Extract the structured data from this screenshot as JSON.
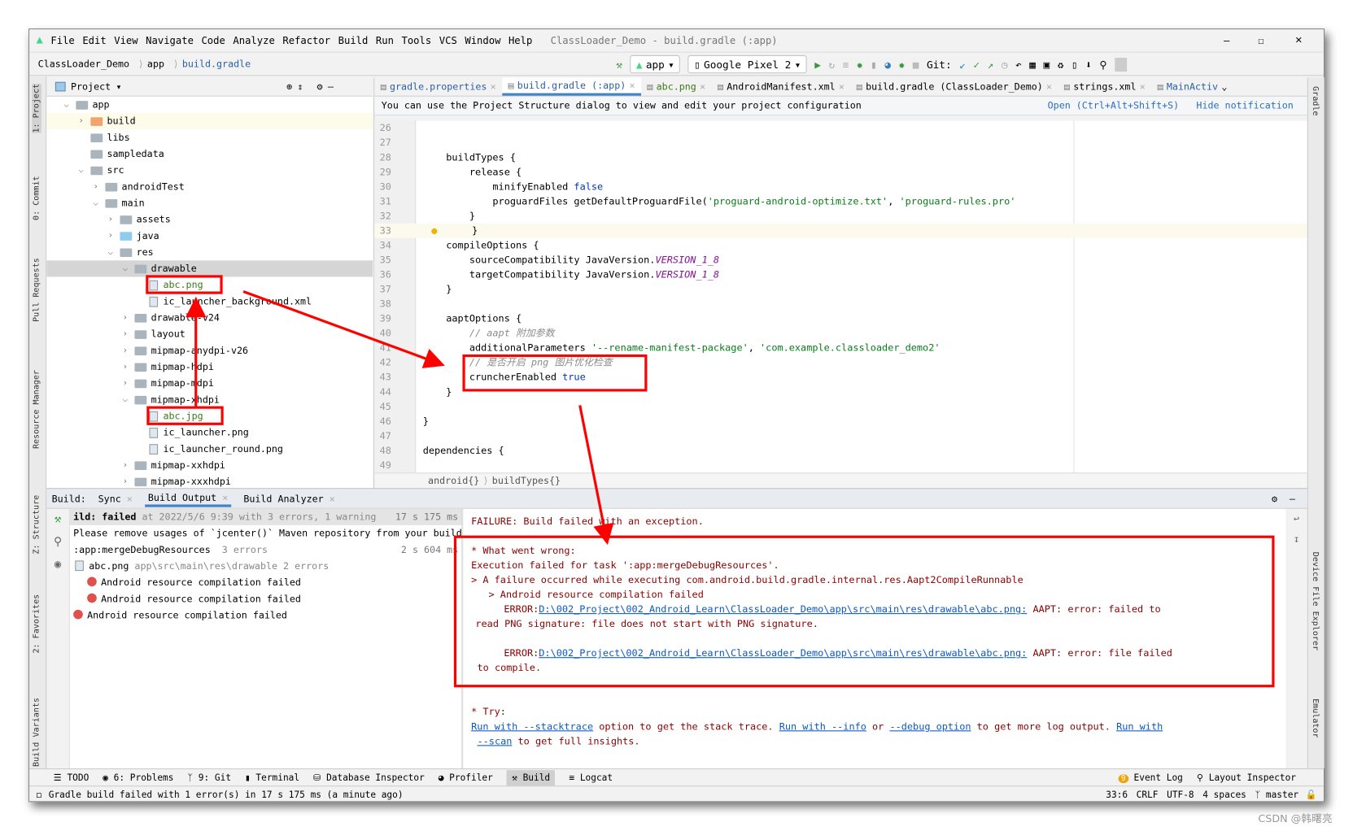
{
  "menu": {
    "items": [
      "File",
      "Edit",
      "View",
      "Navigate",
      "Code",
      "Analyze",
      "Refactor",
      "Build",
      "Run",
      "Tools",
      "VCS",
      "Window",
      "Help"
    ],
    "window_title": "ClassLoader_Demo - build.gradle (:app)"
  },
  "navbar": {
    "crumbs": [
      "ClassLoader_Demo",
      "app",
      "build.gradle"
    ],
    "run_config": "app",
    "device": "Google Pixel 2",
    "git_label": "Git:"
  },
  "project_panel": {
    "title": "Project",
    "tree": [
      {
        "label": "app",
        "depth": 0,
        "chev": "v",
        "type": "module"
      },
      {
        "label": "build",
        "depth": 1,
        "chev": ">",
        "type": "folder-orange"
      },
      {
        "label": "libs",
        "depth": 1,
        "chev": "",
        "type": "folder"
      },
      {
        "label": "sampledata",
        "depth": 1,
        "chev": "",
        "type": "folder"
      },
      {
        "label": "src",
        "depth": 1,
        "chev": "v",
        "type": "folder"
      },
      {
        "label": "androidTest",
        "depth": 2,
        "chev": ">",
        "type": "folder"
      },
      {
        "label": "main",
        "depth": 2,
        "chev": "v",
        "type": "folder"
      },
      {
        "label": "assets",
        "depth": 3,
        "chev": ">",
        "type": "folder"
      },
      {
        "label": "java",
        "depth": 3,
        "chev": ">",
        "type": "folder-blue"
      },
      {
        "label": "res",
        "depth": 3,
        "chev": "v",
        "type": "folder"
      },
      {
        "label": "drawable",
        "depth": 4,
        "chev": "v",
        "type": "folder",
        "selected": true
      },
      {
        "label": "abc.png",
        "depth": 5,
        "chev": "",
        "type": "file",
        "green": true
      },
      {
        "label": "ic_launcher_background.xml",
        "depth": 5,
        "chev": "",
        "type": "file"
      },
      {
        "label": "drawable-v24",
        "depth": 4,
        "chev": ">",
        "type": "folder"
      },
      {
        "label": "layout",
        "depth": 4,
        "chev": ">",
        "type": "folder"
      },
      {
        "label": "mipmap-anydpi-v26",
        "depth": 4,
        "chev": ">",
        "type": "folder"
      },
      {
        "label": "mipmap-hdpi",
        "depth": 4,
        "chev": ">",
        "type": "folder"
      },
      {
        "label": "mipmap-mdpi",
        "depth": 4,
        "chev": ">",
        "type": "folder"
      },
      {
        "label": "mipmap-xhdpi",
        "depth": 4,
        "chev": "v",
        "type": "folder"
      },
      {
        "label": "abc.jpg",
        "depth": 5,
        "chev": "",
        "type": "file",
        "green": true
      },
      {
        "label": "ic_launcher.png",
        "depth": 5,
        "chev": "",
        "type": "file"
      },
      {
        "label": "ic_launcher_round.png",
        "depth": 5,
        "chev": "",
        "type": "file"
      },
      {
        "label": "mipmap-xxhdpi",
        "depth": 4,
        "chev": ">",
        "type": "folder"
      },
      {
        "label": "mipmap-xxxhdpi",
        "depth": 4,
        "chev": ">",
        "type": "folder"
      }
    ]
  },
  "left_stripe": [
    "1: Project",
    "0: Commit",
    "Pull Requests",
    "Resource Manager",
    "Z: Structure",
    "2: Favorites",
    "Build Variants"
  ],
  "right_stripe": [
    "Gradle",
    "Device File Explorer",
    "Emulator"
  ],
  "editor": {
    "tabs": [
      {
        "label": "gradle.properties"
      },
      {
        "label": "build.gradle (:app)",
        "active": true
      },
      {
        "label": "abc.png"
      },
      {
        "label": "AndroidManifest.xml"
      },
      {
        "label": "build.gradle (ClassLoader_Demo)"
      },
      {
        "label": "strings.xml"
      },
      {
        "label": "MainActiv"
      }
    ],
    "notification": {
      "text": "You can use the Project Structure dialog to view and edit your project configuration",
      "open": "Open (Ctrl+Alt+Shift+S)",
      "hide": "Hide notification"
    },
    "lines": [
      {
        "n": "26",
        "segs": []
      },
      {
        "n": "27",
        "segs": []
      },
      {
        "n": "28",
        "segs": [
          [
            "    buildTypes {",
            ""
          ]
        ]
      },
      {
        "n": "29",
        "segs": [
          [
            "        release {",
            ""
          ]
        ]
      },
      {
        "n": "30",
        "segs": [
          [
            "            minifyEnabled ",
            ""
          ],
          [
            "false",
            "kw"
          ]
        ]
      },
      {
        "n": "31",
        "segs": [
          [
            "            proguardFiles getDefaultProguardFile(",
            ""
          ],
          [
            "'proguard-android-optimize.txt'",
            "str"
          ],
          [
            ", ",
            ""
          ],
          [
            "'proguard-rules.pro'",
            "str"
          ]
        ]
      },
      {
        "n": "32",
        "segs": [
          [
            "        }",
            ""
          ]
        ]
      },
      {
        "n": "33",
        "segs": [
          [
            "    }",
            ""
          ]
        ],
        "current": true
      },
      {
        "n": "34",
        "segs": [
          [
            "    compileOptions {",
            ""
          ]
        ]
      },
      {
        "n": "35",
        "segs": [
          [
            "        sourceCompatibility JavaVersion.",
            ""
          ],
          [
            "VERSION_1_8",
            "it"
          ]
        ]
      },
      {
        "n": "36",
        "segs": [
          [
            "        targetCompatibility JavaVersion.",
            ""
          ],
          [
            "VERSION_1_8",
            "it"
          ]
        ]
      },
      {
        "n": "37",
        "segs": [
          [
            "    }",
            ""
          ]
        ]
      },
      {
        "n": "38",
        "segs": []
      },
      {
        "n": "39",
        "segs": [
          [
            "    aaptOptions {",
            ""
          ]
        ]
      },
      {
        "n": "40",
        "segs": [
          [
            "        // aapt 附加参数",
            "cm"
          ]
        ]
      },
      {
        "n": "41",
        "segs": [
          [
            "        additionalParameters ",
            ""
          ],
          [
            "'--rename-manifest-package'",
            "str"
          ],
          [
            ", ",
            ""
          ],
          [
            "'com.example.classloader_demo2'",
            "str"
          ]
        ]
      },
      {
        "n": "42",
        "segs": [
          [
            "        // 是否开启 png 图片优化检查",
            "cm"
          ]
        ]
      },
      {
        "n": "43",
        "segs": [
          [
            "        cruncherEnabled ",
            ""
          ],
          [
            "true",
            "kw"
          ]
        ]
      },
      {
        "n": "44",
        "segs": [
          [
            "    }",
            ""
          ]
        ]
      },
      {
        "n": "45",
        "segs": []
      },
      {
        "n": "46",
        "segs": [
          [
            "}",
            ""
          ]
        ]
      },
      {
        "n": "47",
        "segs": []
      },
      {
        "n": "48",
        "segs": [
          [
            "dependencies {",
            ""
          ]
        ]
      },
      {
        "n": "49",
        "segs": []
      }
    ],
    "breadcrumb": [
      "android{}",
      "buildTypes{}"
    ]
  },
  "build": {
    "label": "Build:",
    "tabs": [
      "Sync",
      "Build Output",
      "Build Analyzer"
    ],
    "tree": [
      {
        "text": "ild: failed",
        "muted": " at 2022/5/6 9:39 with 3 errors, 1 warning",
        "time": "17 s 175 ms",
        "header": true
      },
      {
        "text": "Please remove usages of `jcenter()` Maven repository from your build"
      },
      {
        "text": ":app:mergeDebugResources",
        "muted": "  3 errors",
        "time": "2 s 604 ms"
      },
      {
        "text": "abc.png",
        "muted": " app\\src\\main\\res\\drawable 2 errors",
        "icon": "file"
      },
      {
        "text": "Android resource compilation failed",
        "icon": "error",
        "indent": 2
      },
      {
        "text": "Android resource compilation failed",
        "icon": "error",
        "indent": 2
      },
      {
        "text": "Android resource compilation failed",
        "icon": "error",
        "indent": 0
      }
    ],
    "console": {
      "failure": "FAILURE: Build failed with an exception.",
      "what": "* What went wrong:",
      "exec": "Execution failed for task ':app:mergeDebugResources'.",
      "fail1": "> A failure occurred while executing com.android.build.gradle.internal.res.Aapt2CompileRunnable",
      "fail2": "   > Android resource compilation failed",
      "error_prefix": "ERROR:",
      "error_path": "D:\\002_Project\\002_Android_Learn\\ClassLoader_Demo\\app\\src\\main\\res\\drawable\\abc.png:",
      "err1_tail": " AAPT: error: failed to",
      "err1_cont": "read PNG signature: file does not start with PNG signature.",
      "err2_tail": " AAPT: error: file failed",
      "err2_cont": "to compile.",
      "try": "* Try:",
      "try_l1": "Run with --stacktrace",
      "try_t1": " option to get the stack trace. ",
      "try_l2": "Run with --info",
      "try_t2": " or ",
      "try_l3": "--debug option",
      "try_t3": " to get more log output. ",
      "try_l4": "Run with",
      "try_l5": "--scan",
      "try_t4": " to get full insights."
    }
  },
  "bottom_tools": [
    "TODO",
    "6: Problems",
    "9: Git",
    "Terminal",
    "Database Inspector",
    "Profiler",
    "Build",
    "Logcat"
  ],
  "bottom_right": {
    "event_count": "9",
    "event_log": "Event Log",
    "layout_inspector": "Layout Inspector"
  },
  "status": {
    "message": "Gradle build failed with 1 error(s) in 17 s 175 ms (a minute ago)",
    "position": "33:6",
    "line_sep": "CRLF",
    "encoding": "UTF-8",
    "indent": "4 spaces",
    "branch": "master"
  },
  "watermark": "CSDN @韩曙亮",
  "colors": {
    "annotation": "#ff0000",
    "accent": "#4083c9",
    "error_text": "#8b0000",
    "link": "#0a58c9"
  }
}
